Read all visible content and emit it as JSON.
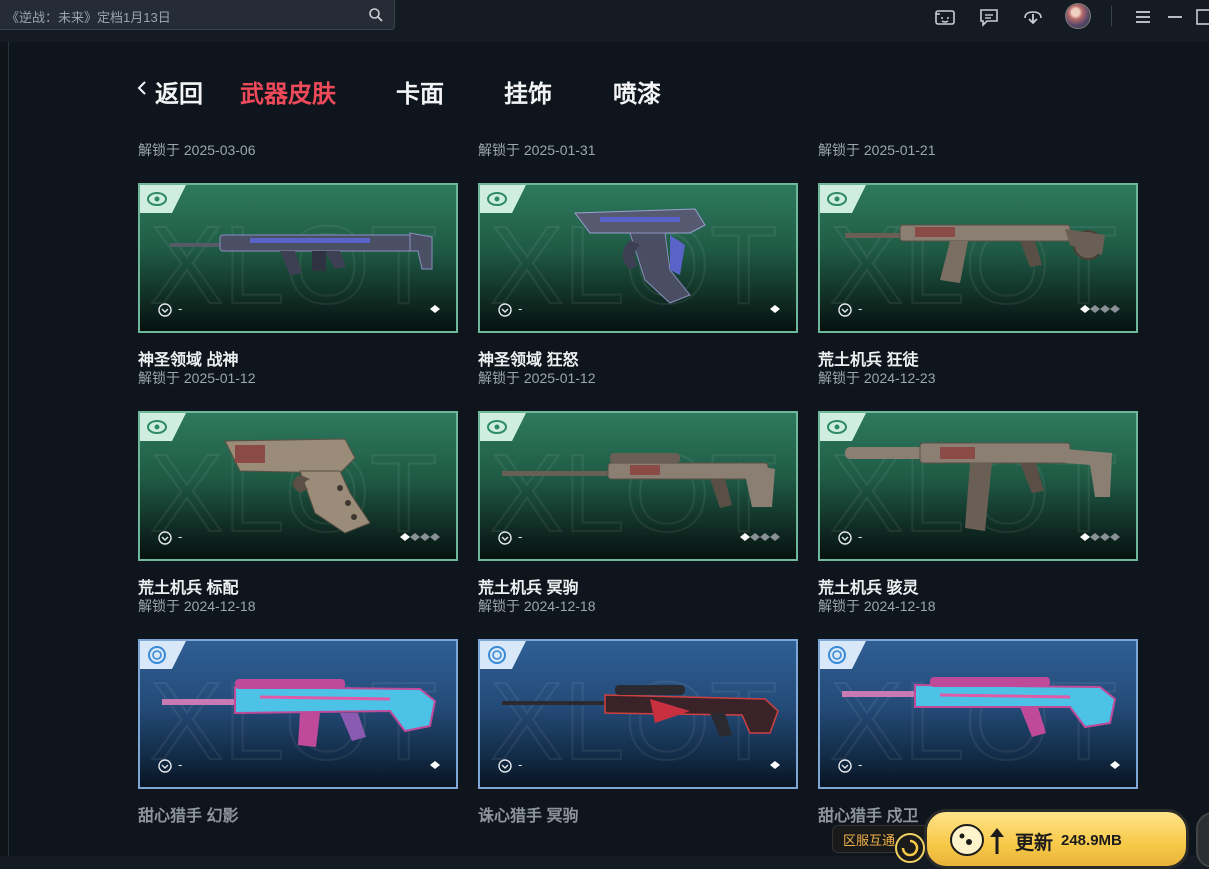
{
  "search": {
    "text": "《逆战：未来》定档1月13日"
  },
  "topbar": {
    "icons": [
      "controller-icon",
      "message-icon",
      "download-icon",
      "avatar",
      "menu-icon",
      "minimize-icon",
      "maximize-icon"
    ]
  },
  "nav": {
    "back_label": "返回",
    "tabs": [
      {
        "label": "武器皮肤",
        "active": true
      },
      {
        "label": "卡面",
        "active": false
      },
      {
        "label": "挂饰",
        "active": false
      },
      {
        "label": "喷漆",
        "active": false
      }
    ]
  },
  "previous_row": [
    {
      "title": "",
      "date": "解锁于 2025-03-06"
    },
    {
      "title": "",
      "date": "解锁于 2025-01-31"
    },
    {
      "title": "",
      "date": "解锁于 2025-01-21"
    }
  ],
  "skins": [
    {
      "title": "神圣领域 战神",
      "date": "解锁于 2025-01-12",
      "price": "-",
      "theme": "green",
      "levels": 1
    },
    {
      "title": "神圣领域 狂怒",
      "date": "解锁于 2025-01-12",
      "price": "-",
      "theme": "green",
      "levels": 1
    },
    {
      "title": "荒土机兵 狂徒",
      "date": "解锁于 2024-12-23",
      "price": "-",
      "theme": "green",
      "levels": 4
    },
    {
      "title": "荒土机兵 标配",
      "date": "解锁于 2024-12-18",
      "price": "-",
      "theme": "green",
      "levels": 4
    },
    {
      "title": "荒土机兵 冥驹",
      "date": "解锁于 2024-12-18",
      "price": "-",
      "theme": "green",
      "levels": 4
    },
    {
      "title": "荒土机兵 骇灵",
      "date": "解锁于 2024-12-18",
      "price": "-",
      "theme": "green",
      "levels": 4
    },
    {
      "title": "甜心猎手 幻影",
      "date": "",
      "price": "-",
      "theme": "blue",
      "levels": 1
    },
    {
      "title": "诛心猎手 冥驹",
      "date": "",
      "price": "-",
      "theme": "blue",
      "levels": 1
    },
    {
      "title": "甜心猎手 戍卫",
      "date": "",
      "price": "-",
      "theme": "blue",
      "levels": 1
    }
  ],
  "update": {
    "label": "更新",
    "size": "248.9MB",
    "region_tag": "区服互通"
  },
  "colors": {
    "active_tab": "#ef4a5a",
    "green_card": "#2e7a5e",
    "blue_card": "#2f5f95",
    "update_btn": "#f7c948"
  }
}
